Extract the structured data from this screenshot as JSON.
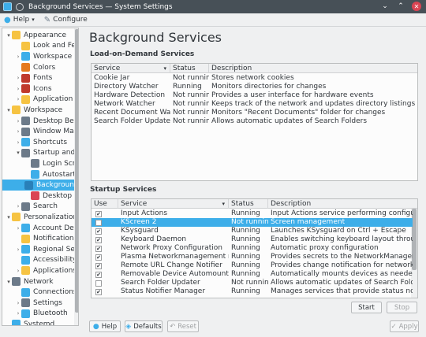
{
  "window": {
    "title": "Background Services — System Settings"
  },
  "toolbar": {
    "help": "Help",
    "configure": "Configure"
  },
  "sidebar": {
    "items": [
      {
        "label": "Appearance",
        "arrow": "▾",
        "color": "#f6c342"
      },
      {
        "label": "Look and Feel",
        "arrow": "",
        "color": "#f6c342"
      },
      {
        "label": "Workspace Theme",
        "arrow": "›",
        "color": "#3daee9"
      },
      {
        "label": "Colors",
        "arrow": "",
        "color": "#e57a1e"
      },
      {
        "label": "Fonts",
        "arrow": "›",
        "color": "#c0392b"
      },
      {
        "label": "Icons",
        "arrow": "›",
        "color": "#c0392b"
      },
      {
        "label": "Application Style",
        "arrow": "›",
        "color": "#f6c342"
      },
      {
        "label": "Workspace",
        "arrow": "▾",
        "color": "#f6c342"
      },
      {
        "label": "Desktop Behavior",
        "arrow": "›",
        "color": "#6c7a89"
      },
      {
        "label": "Window Management",
        "arrow": "›",
        "color": "#6c7a89"
      },
      {
        "label": "Shortcuts",
        "arrow": "›",
        "color": "#3daee9"
      },
      {
        "label": "Startup and Shutdown",
        "arrow": "▾",
        "color": "#6c7a89"
      },
      {
        "label": "Login Screen (SDDM)",
        "arrow": "",
        "color": "#6c7a89"
      },
      {
        "label": "Autostart",
        "arrow": "",
        "color": "#3daee9"
      },
      {
        "label": "Background Services",
        "arrow": "",
        "color": "#2980b9"
      },
      {
        "label": "Desktop Session",
        "arrow": "",
        "color": "#da4453"
      },
      {
        "label": "Search",
        "arrow": "›",
        "color": "#6c7a89"
      },
      {
        "label": "Personalization",
        "arrow": "▾",
        "color": "#f6c342"
      },
      {
        "label": "Account Details",
        "arrow": "›",
        "color": "#3daee9"
      },
      {
        "label": "Notifications",
        "arrow": "",
        "color": "#f6c342"
      },
      {
        "label": "Regional Settings",
        "arrow": "›",
        "color": "#3daee9"
      },
      {
        "label": "Accessibility",
        "arrow": "",
        "color": "#3daee9"
      },
      {
        "label": "Applications",
        "arrow": "›",
        "color": "#f6c342"
      },
      {
        "label": "Network",
        "arrow": "▾",
        "color": "#6c7a89"
      },
      {
        "label": "Connections",
        "arrow": "",
        "color": "#3daee9"
      },
      {
        "label": "Settings",
        "arrow": "›",
        "color": "#6c7a89"
      },
      {
        "label": "Bluetooth",
        "arrow": "›",
        "color": "#3daee9"
      },
      {
        "label": "Systemd",
        "arrow": "",
        "color": "#3daee9"
      }
    ]
  },
  "page": {
    "title": "Background Services",
    "lod_label": "Load-on-Demand Services",
    "startup_label": "Startup Services"
  },
  "lod": {
    "headers": {
      "service": "Service",
      "status": "Status",
      "description": "Description"
    },
    "rows": [
      {
        "service": "Cookie Jar",
        "status": "Not running",
        "description": "Stores network cookies"
      },
      {
        "service": "Directory Watcher",
        "status": "Running",
        "description": "Monitors directories for changes"
      },
      {
        "service": "Hardware Detection",
        "status": "Not running",
        "description": "Provides a user interface for hardware events"
      },
      {
        "service": "Network Watcher",
        "status": "Not running",
        "description": "Keeps track of the network and updates directory listings of the netwo..."
      },
      {
        "service": "Recent Document Watcher",
        "status": "Not running",
        "description": "Monitors \"Recent Documents\" folder for changes"
      },
      {
        "service": "Search Folder Updater",
        "status": "Not running",
        "description": "Allows automatic updates of Search Folders"
      }
    ]
  },
  "startup": {
    "headers": {
      "use": "Use",
      "service": "Service",
      "status": "Status",
      "description": "Description"
    },
    "rows": [
      {
        "service": "Input Actions",
        "status": "Running",
        "description": "Input Actions service performing configured a...",
        "checked": true
      },
      {
        "service": "KScreen 2",
        "status": "Not running",
        "description": "Screen management",
        "checked": false
      },
      {
        "service": "KSysguard",
        "status": "Running",
        "description": "Launches KSysguard on Ctrl + Escape",
        "checked": true
      },
      {
        "service": "Keyboard Daemon",
        "status": "Running",
        "description": "Enables switching keyboard layout through sh...",
        "checked": true
      },
      {
        "service": "Network Proxy Configuration",
        "status": "Running",
        "description": "Automatic proxy configuration",
        "checked": true
      },
      {
        "service": "Plasma Networkmanagement module",
        "status": "Running",
        "description": "Provides secrets to the NetworkManager dae...",
        "checked": true
      },
      {
        "service": "Remote URL Change Notifier",
        "status": "Running",
        "description": "Provides change notification for network fold...",
        "checked": true
      },
      {
        "service": "Removable Device Automounter",
        "status": "Running",
        "description": "Automatically mounts devices as needed",
        "checked": true
      },
      {
        "service": "Search Folder Updater",
        "status": "Not running",
        "description": "Allows automatic updates of Search Folders",
        "checked": false
      },
      {
        "service": "Status Notifier Manager",
        "status": "Running",
        "description": "Manages services that provide status notifier...",
        "checked": true
      }
    ]
  },
  "buttons": {
    "start": "Start",
    "stop": "Stop",
    "help": "Help",
    "defaults": "Defaults",
    "reset": "Reset",
    "apply": "Apply"
  }
}
